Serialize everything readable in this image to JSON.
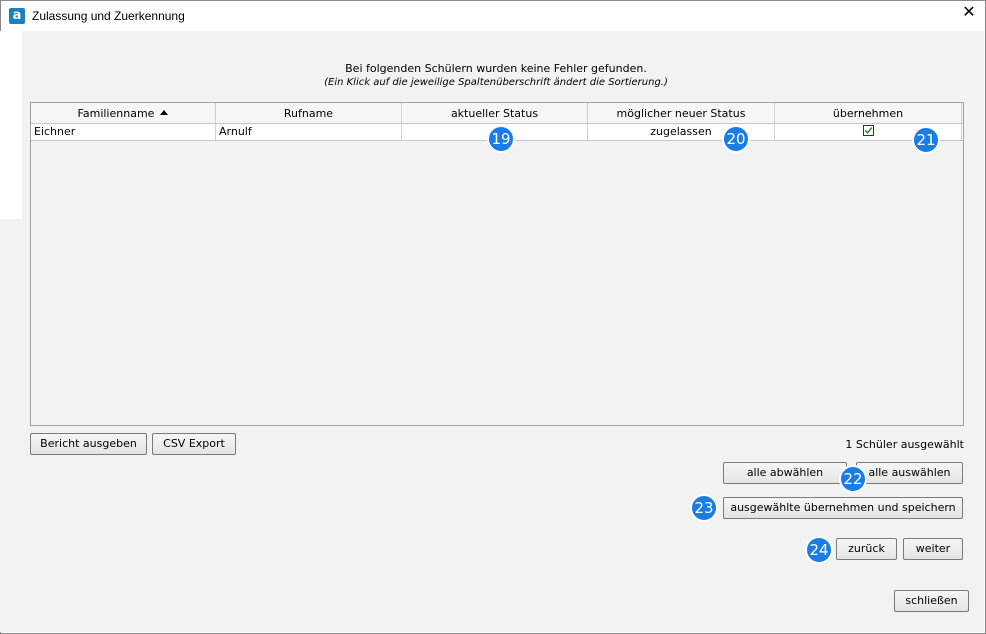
{
  "window": {
    "title": "Zulassung und Zuerkennung",
    "app_icon_glyph": "a",
    "close_glyph": "✕"
  },
  "message": {
    "line1": "Bei folgenden Schülern wurden keine Fehler gefunden.",
    "line2": "(Ein Klick auf die jeweilige Spaltenüberschrift ändert die Sortierung.)"
  },
  "table": {
    "columns": [
      "Familienname",
      "Rufname",
      "aktueller Status",
      "möglicher neuer Status",
      "übernehmen"
    ],
    "sorted_column": "Familienname",
    "sort_direction": "ascending",
    "rows": [
      {
        "familienname": "Eichner",
        "rufname": "Arnulf",
        "aktueller_status": "",
        "neuer_status": "zugelassen",
        "uebernehmen": true
      }
    ]
  },
  "buttons": {
    "bericht": "Bericht ausgeben",
    "csv": "CSV Export",
    "alle_abwaehlen": "alle abwählen",
    "alle_auswaehlen": "alle auswählen",
    "uebernehmen_speichern": "ausgewählte übernehmen und speichern",
    "zurueck": "zurück",
    "weiter": "weiter",
    "schliessen": "schließen"
  },
  "status_text": "1 Schüler ausgewählt",
  "badges": [
    "19",
    "20",
    "21",
    "22",
    "23",
    "24"
  ],
  "colors": {
    "badge": "#1a7de3",
    "app_icon": "#1c7fbf",
    "checkmark": "#2e8b2e"
  }
}
